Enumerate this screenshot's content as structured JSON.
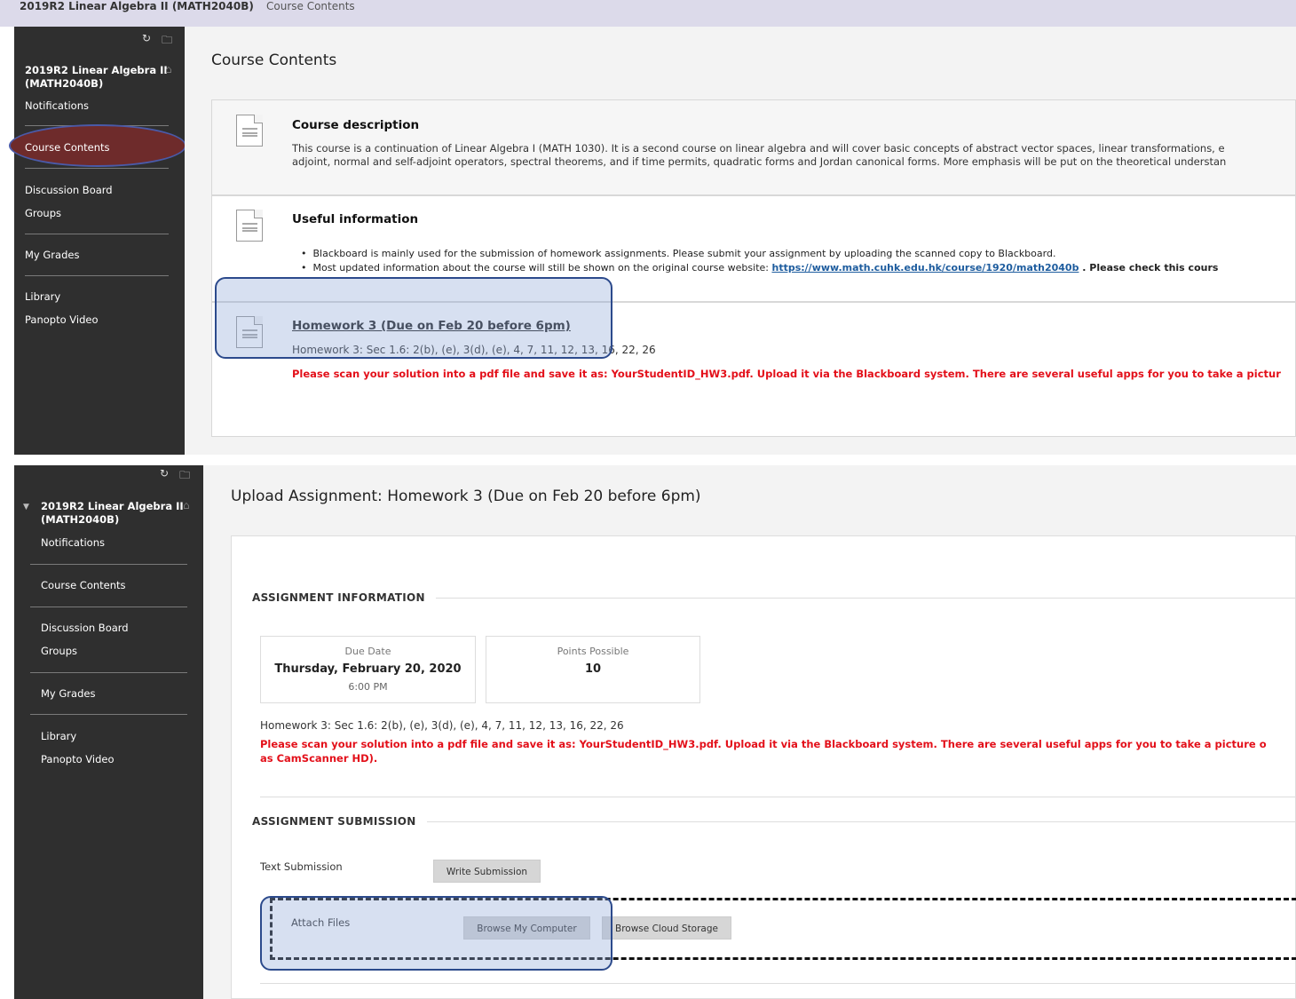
{
  "breadcrumb": {
    "course": "2019R2 Linear Algebra II (MATH2040B)",
    "page": "Course Contents"
  },
  "sidebar": {
    "course_title_line1": "2019R2 Linear Algebra II",
    "course_title_line2": "(MATH2040B)",
    "items": {
      "notifications": "Notifications",
      "course_contents": "Course Contents",
      "discussion_board": "Discussion Board",
      "groups": "Groups",
      "my_grades": "My Grades",
      "library": "Library",
      "panopto_video": "Panopto Video"
    }
  },
  "course_contents": {
    "title": "Course Contents",
    "description": {
      "heading": "Course description",
      "line1": "This course is a continuation of Linear Algebra I (MATH 1030). It is a second course on linear algebra and will cover basic concepts of abstract vector spaces, linear transformations, e",
      "line2": "adjoint, normal and self-adjoint operators, spectral theorems, and if time permits, quadratic forms and Jordan canonical forms. More emphasis will be put on the theoretical understan"
    },
    "useful_info": {
      "heading": "Useful information",
      "bullet1": "Blackboard is mainly used for the submission of homework assignments. Please submit your assignment by uploading the scanned copy to Blackboard.",
      "bullet2_prefix": "Most updated information about the course will still be shown on the original course website: ",
      "bullet2_link": "https://www.math.cuhk.edu.hk/course/1920/math2040b",
      "bullet2_suffix": " . Please check this cours"
    },
    "homework": {
      "link": "Homework 3 (Due on Feb 20 before 6pm)",
      "detail": "Homework 3: Sec 1.6: 2(b), (e), 3(d), (e), 4, 7, 11, 12, 13, 16, 22, 26",
      "instruction": "Please scan your solution into a pdf file and save it as: YourStudentID_HW3.pdf. Upload it via the Blackboard system. There are several useful apps for you to take a pictur"
    }
  },
  "upload": {
    "title": "Upload Assignment: Homework 3 (Due on Feb 20 before 6pm)",
    "info_heading": "ASSIGNMENT INFORMATION",
    "due_label": "Due Date",
    "due_date": "Thursday, February 20, 2020",
    "due_time": "6:00 PM",
    "points_label": "Points Possible",
    "points_value": "10",
    "detail": "Homework 3: Sec 1.6: 2(b), (e), 3(d), (e), 4, 7, 11, 12, 13, 16, 22, 26",
    "instruction_line1": "Please scan your solution into a pdf file and save it as: YourStudentID_HW3.pdf. Upload it via the Blackboard system. There are several useful apps for you to take a picture o",
    "instruction_line2": "as CamScanner HD).",
    "submission_heading": "ASSIGNMENT SUBMISSION",
    "text_submission_label": "Text Submission",
    "write_submission_button": "Write Submission",
    "attach_files_label": "Attach Files",
    "browse_computer_button": "Browse My Computer",
    "browse_cloud_button": "Browse Cloud Storage"
  },
  "icons": {
    "refresh": "refresh-icon",
    "folder": "folder-icon",
    "home": "home-icon",
    "document": "document-icon",
    "caret": "caret-down-icon"
  },
  "colors": {
    "sidebar_bg": "#2f2f2f",
    "active_item": "#6e2b2b",
    "highlight_border": "#2c4a8c",
    "alert_red": "#e3101a",
    "link_blue": "#1d5c9e"
  }
}
